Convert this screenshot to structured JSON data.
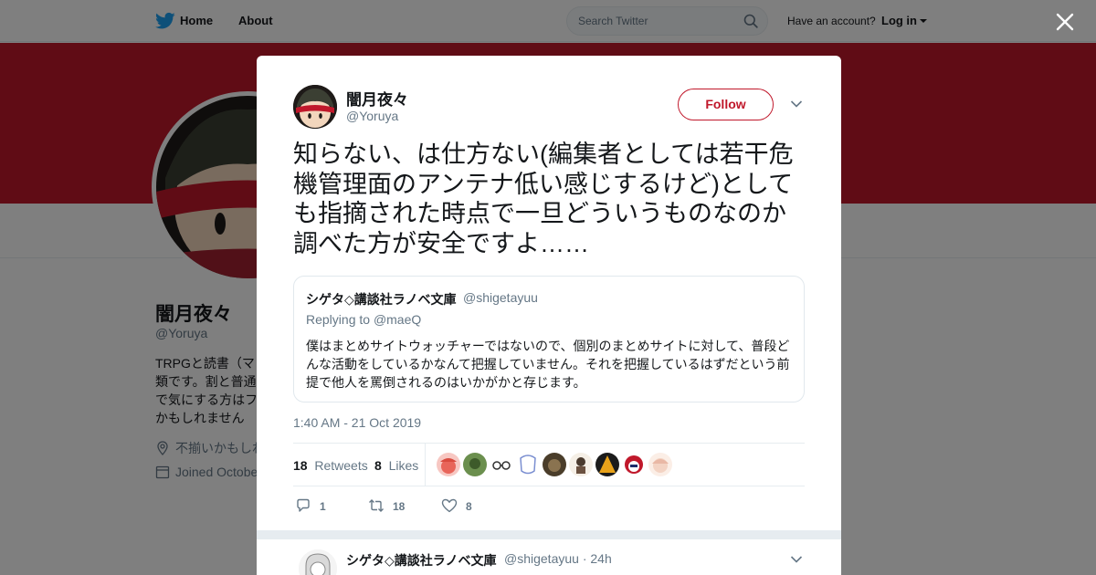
{
  "topbar": {
    "home_label": "Home",
    "about_label": "About",
    "search_placeholder": "Search Twitter",
    "have_account": "Have an account?",
    "login_label": "Log in"
  },
  "profile": {
    "name": "闇月夜々",
    "handle": "@Yoruya",
    "bio_lines": [
      "TRPGと読書（マ",
      "類です。割と普通",
      "で気にする方はフ",
      "かもしれません"
    ],
    "location": "不揃いかもしれ",
    "joined": "Joined Octobe",
    "banner_color": "#c0182b"
  },
  "tweet": {
    "author_name": "闇月夜々",
    "author_handle": "@Yoruya",
    "follow_label": "Follow",
    "text": "知らない、は仕方ない(編集者としては若干危機管理面のアンテナ低い感じするけど)としても指摘された時点で一旦どういうものなのか調べた方が安全ですよ……",
    "quote": {
      "name": "シゲタ◇講談社ラノベ文庫",
      "handle": "@shigetayuu",
      "replying_prefix": "Replying to ",
      "replying_to": "@maeQ",
      "text": "僕はまとめサイトウォッチャーではないので、個別のまとめサイトに対して、普段どんな活動をしているかなんて把握していません。それを把握しているはずだという前提で他人を罵倒されるのはいかがかと存じます。"
    },
    "timestamp": "1:40 AM - 21 Oct 2019",
    "retweets_count": "18",
    "retweets_label": "Retweets",
    "likes_count": "8",
    "likes_label": "Likes",
    "actions": {
      "reply_count": "1",
      "retweet_count": "18",
      "like_count": "8"
    }
  },
  "reply": {
    "name": "シゲタ◇講談社ラノベ文庫",
    "handle": "@shigetayuu",
    "time": "· 24h"
  },
  "colors": {
    "accent": "#c0182b",
    "twitter_blue": "#1da1f2",
    "muted": "#657786"
  }
}
